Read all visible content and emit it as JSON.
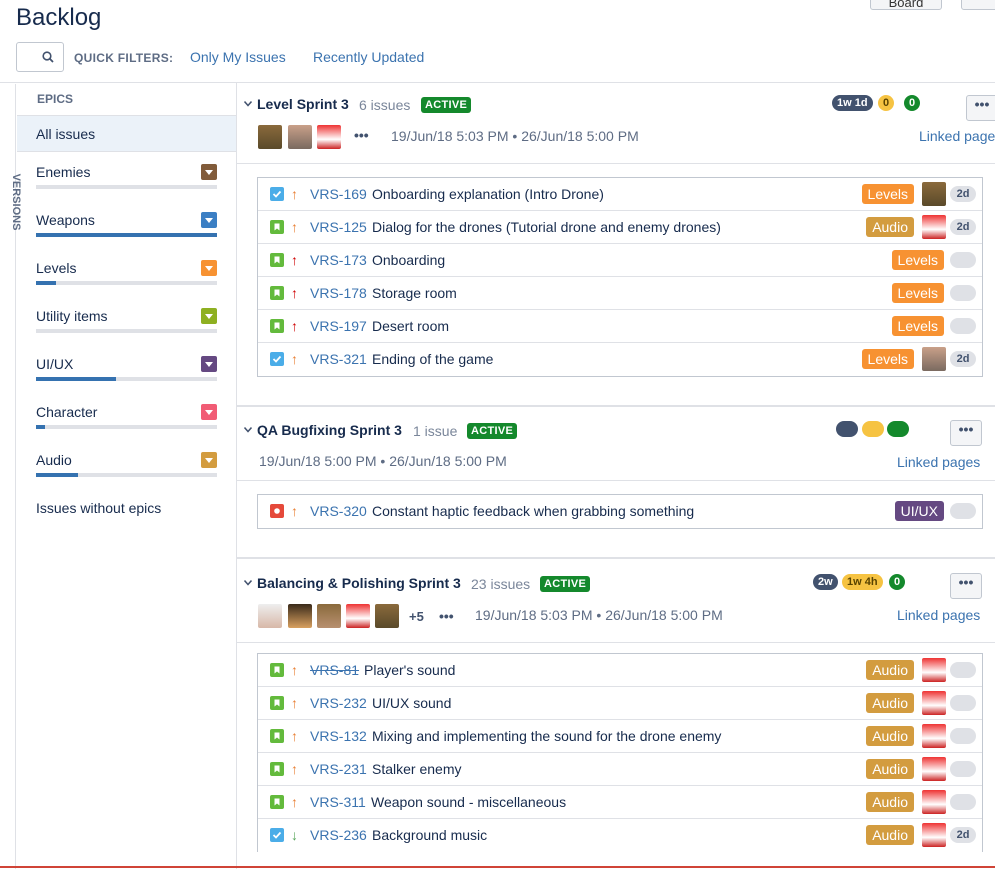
{
  "header": {
    "title": "Backlog",
    "top_button_1": "Board",
    "top_button_2": "",
    "quick_filters_label": "QUICK FILTERS:",
    "filters": [
      "Only My Issues",
      "Recently Updated"
    ]
  },
  "rail": {
    "versions_label": "VERSIONS"
  },
  "epics": {
    "heading": "EPICS",
    "all_issues": "All issues",
    "items": [
      {
        "label": "Enemies",
        "color": "#815b3a",
        "progress": 0
      },
      {
        "label": "Weapons",
        "color": "#3b7fc4",
        "progress": 1.0
      },
      {
        "label": "Levels",
        "color": "#f79232",
        "progress": 0.11
      },
      {
        "label": "Utility items",
        "color": "#8eb021",
        "progress": 0
      },
      {
        "label": "UI/UX",
        "color": "#654982",
        "progress": 0.44
      },
      {
        "label": "Character",
        "color": "#f15c75",
        "progress": 0.05
      },
      {
        "label": "Audio",
        "color": "#d39c3f",
        "progress": 0.23
      }
    ],
    "without_epics": "Issues without epics"
  },
  "sprints": [
    {
      "name": "Level Sprint 3",
      "count": "6 issues",
      "status": "ACTIVE",
      "pills": [
        "1w 1d",
        "0",
        "0"
      ],
      "dates": "19/Jun/18 5:03 PM  •  26/Jun/18 5:00 PM",
      "linked": "Linked page",
      "issues": [
        {
          "type": "task",
          "prio": "↑",
          "key": "VRS-169",
          "summary": "Onboarding explanation (Intro Drone)",
          "epic": "Levels",
          "est": "2d"
        },
        {
          "type": "story",
          "prio": "↑",
          "key": "VRS-125",
          "summary": "Dialog for the drones (Tutorial drone and enemy drones)",
          "epic": "Audio",
          "est": "2d"
        },
        {
          "type": "story",
          "prio": "↑",
          "key": "VRS-173",
          "summary": "Onboarding",
          "epic": "Levels",
          "est": ""
        },
        {
          "type": "story",
          "prio": "↑",
          "key": "VRS-178",
          "summary": "Storage room",
          "epic": "Levels",
          "est": ""
        },
        {
          "type": "story",
          "prio": "↑",
          "key": "VRS-197",
          "summary": "Desert room",
          "epic": "Levels",
          "est": ""
        },
        {
          "type": "task",
          "prio": "↑",
          "key": "VRS-321",
          "summary": "Ending of the game",
          "epic": "Levels",
          "est": "2d"
        }
      ]
    },
    {
      "name": "QA Bugfixing Sprint 3",
      "count": "1 issue",
      "status": "ACTIVE",
      "dates": "19/Jun/18 5:00 PM  •  26/Jun/18 5:00 PM",
      "linked": "Linked pages",
      "issues": [
        {
          "type": "bug",
          "prio": "↑",
          "key": "VRS-320",
          "summary": "Constant haptic feedback when grabbing something",
          "epic": "UI/UX",
          "est": ""
        }
      ]
    },
    {
      "name": "Balancing & Polishing Sprint 3",
      "count": "23 issues",
      "status": "ACTIVE",
      "pills": [
        "2w",
        "1w 4h",
        "0"
      ],
      "more_avatars": "+5",
      "dates": "19/Jun/18 5:03 PM  •  26/Jun/18 5:00 PM",
      "linked": "Linked pages",
      "issues": [
        {
          "type": "story",
          "prio": "↑",
          "key": "VRS-81",
          "summary": "Player's sound",
          "epic": "Audio",
          "est": ""
        },
        {
          "type": "story",
          "prio": "↑",
          "key": "VRS-232",
          "summary": "UI/UX sound",
          "epic": "Audio",
          "est": ""
        },
        {
          "type": "story",
          "prio": "↑",
          "key": "VRS-132",
          "summary": "Mixing and implementing the sound for the drone enemy",
          "epic": "Audio",
          "est": ""
        },
        {
          "type": "story",
          "prio": "↑",
          "key": "VRS-231",
          "summary": "Stalker enemy",
          "epic": "Audio",
          "est": ""
        },
        {
          "type": "story",
          "prio": "↑",
          "key": "VRS-311",
          "summary": "Weapon sound - miscellaneous",
          "epic": "Audio",
          "est": ""
        },
        {
          "type": "task",
          "prio": "↓",
          "key": "VRS-236",
          "summary": "Background music",
          "epic": "Audio",
          "est": "2d"
        }
      ]
    }
  ],
  "colors": {
    "levels": "#f79232",
    "audio": "#d39c3f",
    "uiux": "#654982",
    "link": "#3b73af",
    "active": "#14892c"
  }
}
